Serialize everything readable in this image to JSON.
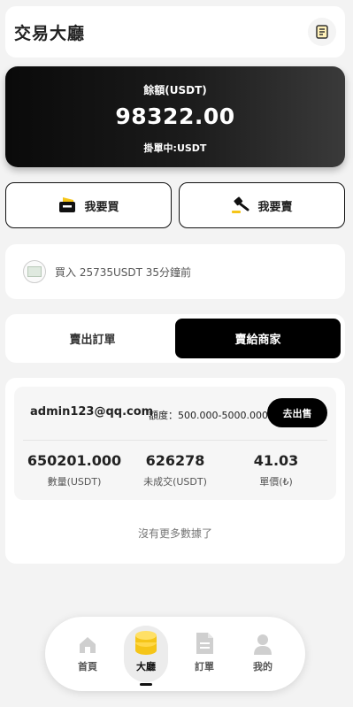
{
  "header": {
    "title": "交易大廳",
    "icon": "document-icon"
  },
  "balance": {
    "label": "餘額(USDT)",
    "amount": "98322.00",
    "pending": "掛單中:USDT"
  },
  "actions": {
    "buy_label": "我要買",
    "sell_label": "我要賣"
  },
  "ticker": {
    "text": "買入 25735USDT 35分鐘前"
  },
  "tabs": [
    {
      "label": "賣出訂單",
      "active": false
    },
    {
      "label": "賣給商家",
      "active": true
    }
  ],
  "listing": {
    "email": "admin123@qq.com",
    "quota": "額度：500.000-5000.000",
    "go_label": "去出售",
    "stats": [
      {
        "value": "650201.000",
        "label": "數量(USDT)"
      },
      {
        "value": "626278",
        "label": "未成交(USDT)"
      },
      {
        "value": "41.03",
        "label": "單價(₺)"
      }
    ],
    "no_more": "沒有更多數據了"
  },
  "nav": [
    {
      "label": "首頁",
      "icon": "home-icon"
    },
    {
      "label": "大廳",
      "icon": "coins-icon",
      "active": true
    },
    {
      "label": "訂單",
      "icon": "orders-icon"
    },
    {
      "label": "我的",
      "icon": "user-icon"
    }
  ],
  "colors": {
    "accent": "#f5c518",
    "dark": "#000000",
    "background": "#f3f3f3"
  }
}
